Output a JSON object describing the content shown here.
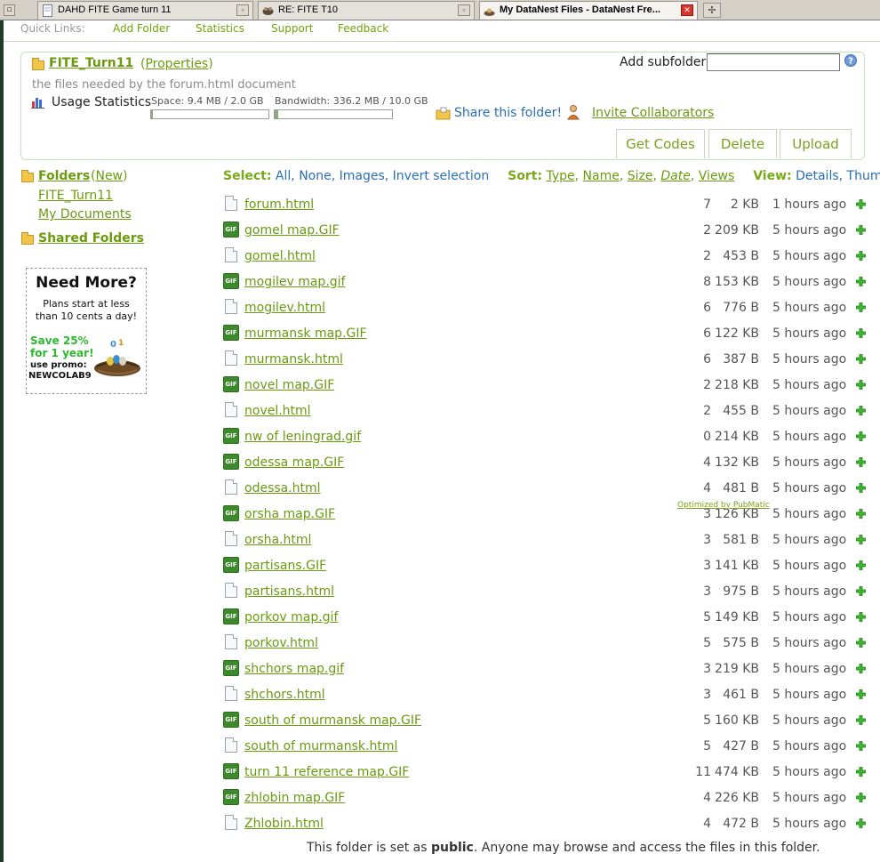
{
  "browser": {
    "tabs": [
      {
        "label": "DAHD FITE Game turn 11",
        "icon": "document-icon"
      },
      {
        "label": "RE: FITE T10",
        "icon": "forum-icon"
      },
      {
        "label": "My DataNest Files - DataNest Fre...",
        "icon": "datanest-icon"
      }
    ]
  },
  "quick_links": {
    "label": "Quick Links:",
    "items": [
      "Add Folder",
      "Statistics",
      "Support",
      "Feedback"
    ]
  },
  "folder": {
    "name": "FITE_Turn11",
    "properties_label": "Properties",
    "description": "the files needed by the forum.html document",
    "usage_label": "Usage Statistics",
    "space_text": "Space: 9.4 MB / 2.0 GB",
    "space_fraction": 0.005,
    "bandwidth_text": "Bandwidth: 336.2 MB / 10.0 GB",
    "bandwidth_fraction": 0.034,
    "add_subfolder_label": "Add subfolder:",
    "add_subfolder_value": "",
    "share_label": "Share this folder!",
    "invite_label": "Invite Collaborators",
    "buttons": {
      "get_codes": "Get Codes",
      "delete": "Delete",
      "upload": "Upload"
    }
  },
  "sidebar": {
    "folders_label": "Folders",
    "new_label": "New",
    "items": [
      "FITE_Turn11",
      "My Documents"
    ],
    "shared_label": "Shared Folders"
  },
  "promo": {
    "title": "Need More?",
    "line1": "Plans start at less",
    "line2": "than 10 cents a day!",
    "save1": "Save 25%",
    "save2": "for 1 year!",
    "promo_label": "use promo:",
    "code": "NEWCOLAB9"
  },
  "toolbar": {
    "select_label": "Select:",
    "select": [
      "All",
      "None",
      "Images",
      "Invert selection"
    ],
    "sort_label": "Sort:",
    "sort": [
      "Type",
      "Name",
      "Size",
      "Date",
      "Views"
    ],
    "view_label": "View:",
    "view": [
      "Details",
      "Thumbs"
    ]
  },
  "files": [
    {
      "name": "forum.html",
      "type": "html",
      "views": "7",
      "size": "2 KB",
      "time": "1 hours ago"
    },
    {
      "name": "gomel map.GIF",
      "type": "gif",
      "views": "2",
      "size": "209 KB",
      "time": "5 hours ago"
    },
    {
      "name": "gomel.html",
      "type": "html",
      "views": "2",
      "size": "453 B",
      "time": "5 hours ago"
    },
    {
      "name": "mogilev map.gif",
      "type": "gif",
      "views": "8",
      "size": "153 KB",
      "time": "5 hours ago"
    },
    {
      "name": "mogilev.html",
      "type": "html",
      "views": "6",
      "size": "776 B",
      "time": "5 hours ago"
    },
    {
      "name": "murmansk map.GIF",
      "type": "gif",
      "views": "6",
      "size": "122 KB",
      "time": "5 hours ago"
    },
    {
      "name": "murmansk.html",
      "type": "html",
      "views": "6",
      "size": "387 B",
      "time": "5 hours ago"
    },
    {
      "name": "novel map.GIF",
      "type": "gif",
      "views": "2",
      "size": "218 KB",
      "time": "5 hours ago"
    },
    {
      "name": "novel.html",
      "type": "html",
      "views": "2",
      "size": "455 B",
      "time": "5 hours ago"
    },
    {
      "name": "nw of leningrad.gif",
      "type": "gif",
      "views": "0",
      "size": "214 KB",
      "time": "5 hours ago"
    },
    {
      "name": "odessa map.GIF",
      "type": "gif",
      "views": "4",
      "size": "132 KB",
      "time": "5 hours ago"
    },
    {
      "name": "odessa.html",
      "type": "html",
      "views": "4",
      "size": "481 B",
      "time": "5 hours ago"
    },
    {
      "name": "orsha map.GIF",
      "type": "gif",
      "views": "3",
      "size": "126 KB",
      "time": "5 hours ago"
    },
    {
      "name": "orsha.html",
      "type": "html",
      "views": "3",
      "size": "581 B",
      "time": "5 hours ago"
    },
    {
      "name": "partisans.GIF",
      "type": "gif",
      "views": "3",
      "size": "141 KB",
      "time": "5 hours ago"
    },
    {
      "name": "partisans.html",
      "type": "html",
      "views": "3",
      "size": "975 B",
      "time": "5 hours ago"
    },
    {
      "name": "porkov map.gif",
      "type": "gif",
      "views": "5",
      "size": "149 KB",
      "time": "5 hours ago"
    },
    {
      "name": "porkov.html",
      "type": "html",
      "views": "5",
      "size": "575 B",
      "time": "5 hours ago"
    },
    {
      "name": "shchors map.gif",
      "type": "gif",
      "views": "3",
      "size": "219 KB",
      "time": "5 hours ago"
    },
    {
      "name": "shchors.html",
      "type": "html",
      "views": "3",
      "size": "461 B",
      "time": "5 hours ago"
    },
    {
      "name": "south of murmansk map.GIF",
      "type": "gif",
      "views": "5",
      "size": "160 KB",
      "time": "5 hours ago"
    },
    {
      "name": "south of murmansk.html",
      "type": "html",
      "views": "5",
      "size": "427 B",
      "time": "5 hours ago"
    },
    {
      "name": "turn 11 reference map.GIF",
      "type": "gif",
      "views": "11",
      "size": "474 KB",
      "time": "5 hours ago"
    },
    {
      "name": "zhlobin map.GIF",
      "type": "gif",
      "views": "4",
      "size": "226 KB",
      "time": "5 hours ago"
    },
    {
      "name": "Zhlobin.html",
      "type": "html",
      "views": "4",
      "size": "472 B",
      "time": "5 hours ago"
    }
  ],
  "gif_badge": "GIF",
  "ad_label": "Optimized by PubMatic",
  "footer": {
    "before": "This folder is set as ",
    "bold": "public",
    "after": ". Anyone may browse and access the files in this folder."
  },
  "colors": {
    "accent": "#74a20b",
    "link_blue": "#2a6fb3",
    "panel_border": "#c5e3b9"
  }
}
